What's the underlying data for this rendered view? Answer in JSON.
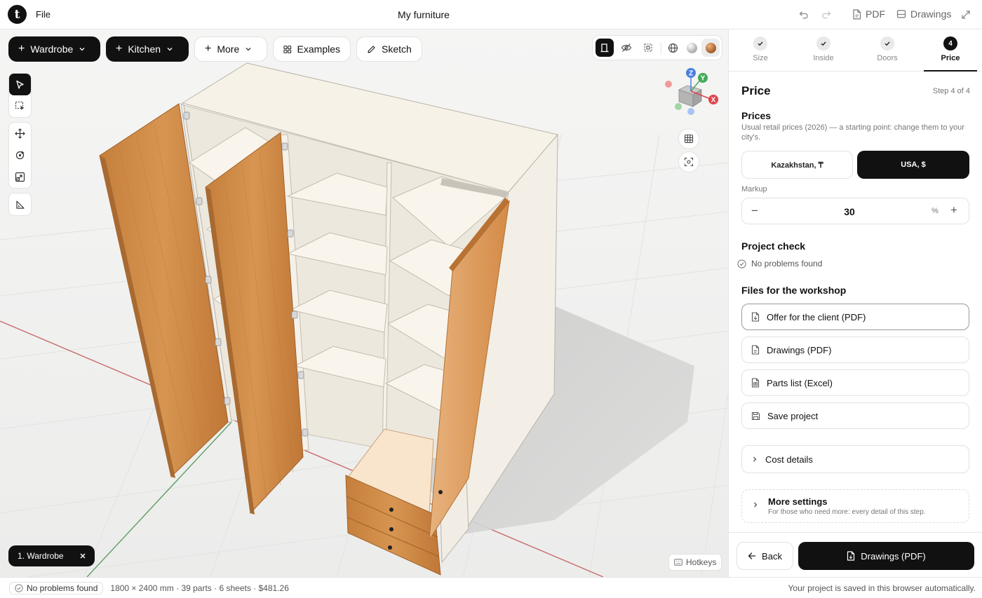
{
  "app": {
    "menu_file": "File",
    "title": "My furniture"
  },
  "topbar": {
    "pdf_label": "PDF",
    "drawings_label": "Drawings"
  },
  "toolbar": {
    "wardrobe": "Wardrobe",
    "kitchen": "Kitchen",
    "more": "More",
    "examples": "Examples",
    "sketch": "Sketch"
  },
  "axes": {
    "z": "Z",
    "y": "Y",
    "x": "X"
  },
  "viewport": {
    "chip_label": "1. Wardrobe",
    "hotkeys": "Hotkeys"
  },
  "status": {
    "problems": "No problems found",
    "summary": "1800 × 2400 mm · 39 parts · 6 sheets · $481.26",
    "saved": "Your project is saved in this browser automatically."
  },
  "steps": [
    {
      "label": "Size",
      "state": "done"
    },
    {
      "label": "Inside",
      "state": "done"
    },
    {
      "label": "Doors",
      "state": "done"
    },
    {
      "label": "Price",
      "number": "4",
      "state": "active"
    }
  ],
  "panel": {
    "title": "Price",
    "step_of": "Step 4 of 4",
    "prices_heading": "Prices",
    "prices_note": "Usual retail prices (2026) — a starting point: change them to your city's.",
    "region_options": [
      "Kazakhstan, ₸",
      "USA, $"
    ],
    "region_selected": "USA, $",
    "markup_label": "Markup",
    "markup_value": "30",
    "markup_unit": "%",
    "project_check_heading": "Project check",
    "project_check_result": "No problems found",
    "files_heading": "Files for the workshop",
    "files": [
      "Offer for the client (PDF)",
      "Drawings (PDF)",
      "Parts list (Excel)",
      "Save project"
    ],
    "cost_details": "Cost details",
    "more_settings_title": "More settings",
    "more_settings_sub": "For those who need more: every detail of this step.",
    "back": "Back",
    "primary": "Drawings (PDF)"
  },
  "colors": {
    "accent": "#111111",
    "wood": "#c8833f",
    "carcass": "#f6f2ea",
    "axis_x": "#e0464c",
    "axis_y": "#45a95a",
    "axis_z": "#4a7fe0"
  }
}
